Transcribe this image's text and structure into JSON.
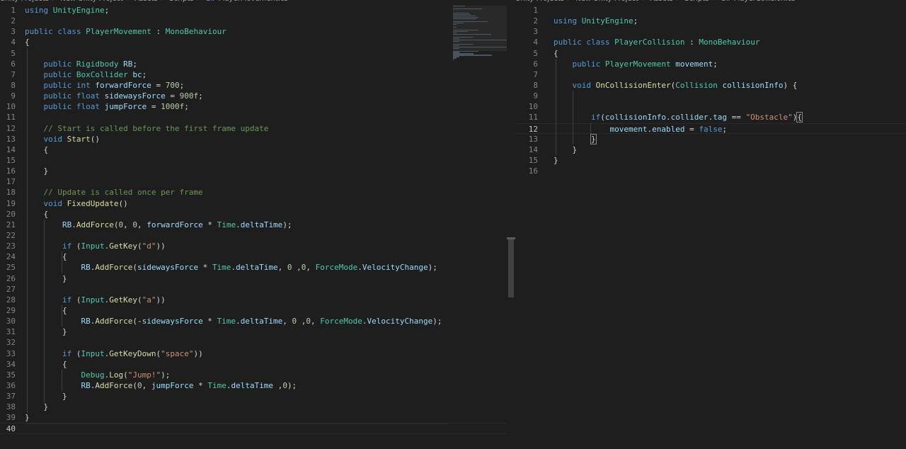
{
  "left_editor": {
    "breadcrumb": [
      "Unity Projects",
      "New Unity Project",
      "Assets",
      "Scripts",
      "PlayerMovement.cs"
    ],
    "current_line": 40,
    "lines": [
      [
        [
          "kw",
          "using"
        ],
        [
          "t",
          " "
        ],
        [
          "cls",
          "UnityEngine"
        ],
        [
          "t",
          ";"
        ]
      ],
      [],
      [
        [
          "kw",
          "public"
        ],
        [
          "t",
          " "
        ],
        [
          "kw",
          "class"
        ],
        [
          "t",
          " "
        ],
        [
          "cls",
          "PlayerMovement"
        ],
        [
          "t",
          " : "
        ],
        [
          "cls",
          "MonoBehaviour"
        ]
      ],
      [
        [
          "t",
          "{"
        ]
      ],
      [],
      [
        [
          "t",
          "    "
        ],
        [
          "kw",
          "public"
        ],
        [
          "t",
          " "
        ],
        [
          "cls",
          "Rigidbody"
        ],
        [
          "t",
          " "
        ],
        [
          "vr",
          "RB"
        ],
        [
          "t",
          ";"
        ]
      ],
      [
        [
          "t",
          "    "
        ],
        [
          "kw",
          "public"
        ],
        [
          "t",
          " "
        ],
        [
          "cls",
          "BoxCollider"
        ],
        [
          "t",
          " "
        ],
        [
          "vr",
          "bc"
        ],
        [
          "t",
          ";"
        ]
      ],
      [
        [
          "t",
          "    "
        ],
        [
          "kw",
          "public"
        ],
        [
          "t",
          " "
        ],
        [
          "kw",
          "int"
        ],
        [
          "t",
          " "
        ],
        [
          "vr",
          "forwardForce"
        ],
        [
          "t",
          " = "
        ],
        [
          "num",
          "700"
        ],
        [
          "t",
          ";"
        ]
      ],
      [
        [
          "t",
          "    "
        ],
        [
          "kw",
          "public"
        ],
        [
          "t",
          " "
        ],
        [
          "kw",
          "float"
        ],
        [
          "t",
          " "
        ],
        [
          "vr",
          "sidewaysForce"
        ],
        [
          "t",
          " = "
        ],
        [
          "num",
          "900f"
        ],
        [
          "t",
          ";"
        ]
      ],
      [
        [
          "t",
          "    "
        ],
        [
          "kw",
          "public"
        ],
        [
          "t",
          " "
        ],
        [
          "kw",
          "float"
        ],
        [
          "t",
          " "
        ],
        [
          "vr",
          "jumpForce"
        ],
        [
          "t",
          " = "
        ],
        [
          "num",
          "1000f"
        ],
        [
          "t",
          ";"
        ]
      ],
      [],
      [
        [
          "t",
          "    "
        ],
        [
          "cm",
          "// Start is called before the first frame update"
        ]
      ],
      [
        [
          "t",
          "    "
        ],
        [
          "kw",
          "void"
        ],
        [
          "t",
          " "
        ],
        [
          "fn",
          "Start"
        ],
        [
          "t",
          "()"
        ]
      ],
      [
        [
          "t",
          "    {"
        ]
      ],
      [],
      [
        [
          "t",
          "    }"
        ]
      ],
      [],
      [
        [
          "t",
          "    "
        ],
        [
          "cm",
          "// Update is called once per frame"
        ]
      ],
      [
        [
          "t",
          "    "
        ],
        [
          "kw",
          "void"
        ],
        [
          "t",
          " "
        ],
        [
          "fn",
          "FixedUpdate"
        ],
        [
          "t",
          "()"
        ]
      ],
      [
        [
          "t",
          "    {"
        ]
      ],
      [
        [
          "t",
          "        "
        ],
        [
          "vr",
          "RB"
        ],
        [
          "t",
          "."
        ],
        [
          "fn",
          "AddForce"
        ],
        [
          "t",
          "("
        ],
        [
          "num",
          "0"
        ],
        [
          "t",
          ", "
        ],
        [
          "num",
          "0"
        ],
        [
          "t",
          ", "
        ],
        [
          "vr",
          "forwardForce"
        ],
        [
          "t",
          " * "
        ],
        [
          "cls",
          "Time"
        ],
        [
          "t",
          "."
        ],
        [
          "vr",
          "deltaTime"
        ],
        [
          "t",
          ");"
        ]
      ],
      [],
      [
        [
          "t",
          "        "
        ],
        [
          "kw",
          "if"
        ],
        [
          "t",
          " ("
        ],
        [
          "cls",
          "Input"
        ],
        [
          "t",
          "."
        ],
        [
          "fn",
          "GetKey"
        ],
        [
          "t",
          "("
        ],
        [
          "str",
          "\"d\""
        ],
        [
          "t",
          "))"
        ]
      ],
      [
        [
          "t",
          "        {"
        ]
      ],
      [
        [
          "t",
          "            "
        ],
        [
          "vr",
          "RB"
        ],
        [
          "t",
          "."
        ],
        [
          "fn",
          "AddForce"
        ],
        [
          "t",
          "("
        ],
        [
          "vr",
          "sidewaysForce"
        ],
        [
          "t",
          " * "
        ],
        [
          "cls",
          "Time"
        ],
        [
          "t",
          "."
        ],
        [
          "vr",
          "deltaTime"
        ],
        [
          "t",
          ", "
        ],
        [
          "num",
          "0"
        ],
        [
          "t",
          " ,"
        ],
        [
          "num",
          "0"
        ],
        [
          "t",
          ", "
        ],
        [
          "cls",
          "ForceMode"
        ],
        [
          "t",
          "."
        ],
        [
          "vr",
          "VelocityChange"
        ],
        [
          "t",
          ");"
        ]
      ],
      [
        [
          "t",
          "        }"
        ]
      ],
      [],
      [
        [
          "t",
          "        "
        ],
        [
          "kw",
          "if"
        ],
        [
          "t",
          " ("
        ],
        [
          "cls",
          "Input"
        ],
        [
          "t",
          "."
        ],
        [
          "fn",
          "GetKey"
        ],
        [
          "t",
          "("
        ],
        [
          "str",
          "\"a\""
        ],
        [
          "t",
          "))"
        ]
      ],
      [
        [
          "t",
          "        {"
        ]
      ],
      [
        [
          "t",
          "            "
        ],
        [
          "vr",
          "RB"
        ],
        [
          "t",
          "."
        ],
        [
          "fn",
          "AddForce"
        ],
        [
          "t",
          "(-"
        ],
        [
          "vr",
          "sidewaysForce"
        ],
        [
          "t",
          " * "
        ],
        [
          "cls",
          "Time"
        ],
        [
          "t",
          "."
        ],
        [
          "vr",
          "deltaTime"
        ],
        [
          "t",
          ", "
        ],
        [
          "num",
          "0"
        ],
        [
          "t",
          " ,"
        ],
        [
          "num",
          "0"
        ],
        [
          "t",
          ", "
        ],
        [
          "cls",
          "ForceMode"
        ],
        [
          "t",
          "."
        ],
        [
          "vr",
          "VelocityChange"
        ],
        [
          "t",
          ");"
        ]
      ],
      [
        [
          "t",
          "        }"
        ]
      ],
      [],
      [
        [
          "t",
          "        "
        ],
        [
          "kw",
          "if"
        ],
        [
          "t",
          " ("
        ],
        [
          "cls",
          "Input"
        ],
        [
          "t",
          "."
        ],
        [
          "fn",
          "GetKeyDown"
        ],
        [
          "t",
          "("
        ],
        [
          "str",
          "\"space\""
        ],
        [
          "t",
          "))"
        ]
      ],
      [
        [
          "t",
          "        {"
        ]
      ],
      [
        [
          "t",
          "            "
        ],
        [
          "cls",
          "Debug"
        ],
        [
          "t",
          "."
        ],
        [
          "fn",
          "Log"
        ],
        [
          "t",
          "("
        ],
        [
          "str",
          "\"Jump!\""
        ],
        [
          "t",
          ");"
        ]
      ],
      [
        [
          "t",
          "            "
        ],
        [
          "vr",
          "RB"
        ],
        [
          "t",
          "."
        ],
        [
          "fn",
          "AddForce"
        ],
        [
          "t",
          "("
        ],
        [
          "num",
          "0"
        ],
        [
          "t",
          ", "
        ],
        [
          "vr",
          "jumpForce"
        ],
        [
          "t",
          " * "
        ],
        [
          "cls",
          "Time"
        ],
        [
          "t",
          "."
        ],
        [
          "vr",
          "deltaTime"
        ],
        [
          "t",
          " ,"
        ],
        [
          "num",
          "0"
        ],
        [
          "t",
          ");"
        ]
      ],
      [
        [
          "t",
          "        }"
        ]
      ],
      [
        [
          "t",
          "    }"
        ]
      ],
      [
        [
          "t",
          "}"
        ]
      ],
      []
    ]
  },
  "right_editor": {
    "breadcrumb": [
      "Unity Projects",
      "New Unity Project",
      "Assets",
      "Scripts",
      "PlayerCollision.cs"
    ],
    "current_line": 12,
    "lines": [
      [],
      [
        [
          "kw",
          "using"
        ],
        [
          "t",
          " "
        ],
        [
          "cls",
          "UnityEngine"
        ],
        [
          "t",
          ";"
        ]
      ],
      [],
      [
        [
          "kw",
          "public"
        ],
        [
          "t",
          " "
        ],
        [
          "kw",
          "class"
        ],
        [
          "t",
          " "
        ],
        [
          "cls",
          "PlayerCollision"
        ],
        [
          "t",
          " : "
        ],
        [
          "cls",
          "MonoBehaviour"
        ]
      ],
      [
        [
          "t",
          "{"
        ]
      ],
      [
        [
          "t",
          "    "
        ],
        [
          "kw",
          "public"
        ],
        [
          "t",
          " "
        ],
        [
          "cls",
          "PlayerMovement"
        ],
        [
          "t",
          " "
        ],
        [
          "vr",
          "movement"
        ],
        [
          "t",
          ";"
        ]
      ],
      [],
      [
        [
          "t",
          "    "
        ],
        [
          "kw",
          "void"
        ],
        [
          "t",
          " "
        ],
        [
          "fn",
          "OnCollisionEnter"
        ],
        [
          "t",
          "("
        ],
        [
          "cls",
          "Collision"
        ],
        [
          "t",
          " "
        ],
        [
          "vr",
          "collisionInfo"
        ],
        [
          "t",
          ") {"
        ]
      ],
      [],
      [],
      [
        [
          "t",
          "        "
        ],
        [
          "kw",
          "if"
        ],
        [
          "t",
          "("
        ],
        [
          "vr",
          "collisionInfo"
        ],
        [
          "t",
          "."
        ],
        [
          "vr",
          "collider"
        ],
        [
          "t",
          "."
        ],
        [
          "vr",
          "tag"
        ],
        [
          "t",
          " == "
        ],
        [
          "str",
          "\"Obstacle\""
        ],
        [
          "t",
          ")"
        ],
        [
          "brk",
          "{"
        ]
      ],
      [
        [
          "t",
          "            "
        ],
        [
          "vr",
          "movement"
        ],
        [
          "t",
          "."
        ],
        [
          "vr",
          "enabled"
        ],
        [
          "t",
          " = "
        ],
        [
          "kw",
          "false"
        ],
        [
          "t",
          ";"
        ]
      ],
      [
        [
          "t",
          "        "
        ],
        [
          "brk",
          "}"
        ]
      ],
      [
        [
          "t",
          "    }"
        ]
      ],
      [
        [
          "t",
          "}"
        ]
      ],
      []
    ]
  }
}
